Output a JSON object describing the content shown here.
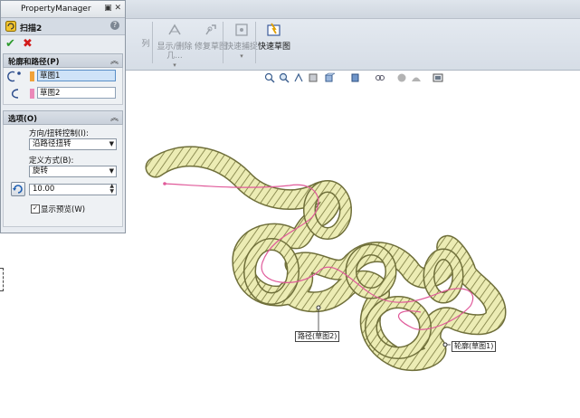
{
  "property_manager": {
    "title": "PropertyManager",
    "feature_name": "扫描2",
    "help": "?",
    "ok_symbol": "✔",
    "cancel_symbol": "✖",
    "profile_path_group": {
      "header": "轮廓和路径(P)",
      "profile_value": "草图1",
      "path_value": "草图2",
      "profile_color": "#f0a23a",
      "path_color": "#ea89b9"
    },
    "options_group": {
      "header": "选项(O)",
      "orientation_label": "方向/扭转控制(I):",
      "orientation_value": "沿路径扭转",
      "define_by_label": "定义方式(B):",
      "define_by_value": "旋转",
      "twist_value": "10.00",
      "show_preview_label": "显示预览(W)",
      "show_preview_checked": true
    }
  },
  "ribbon": {
    "items": [
      {
        "label": "列",
        "enabled": false
      },
      {
        "label": "显示/删除几...",
        "enabled": false
      },
      {
        "label": "修复草图",
        "enabled": false
      },
      {
        "label": "快速捕捉",
        "enabled": false
      },
      {
        "label": "快速草图",
        "enabled": true
      }
    ]
  },
  "view_toolbar": {
    "icons": [
      "zoom-to-fit-icon",
      "zoom-area-icon",
      "previous-view-icon",
      "section-view-icon",
      "view-orientation-icon",
      "display-style-icon",
      "hide-show-icon",
      "edit-appearance-icon",
      "apply-scene-icon",
      "view-settings-icon"
    ]
  },
  "graphics": {
    "sweep_color": "#e6e6a0",
    "path_line_color": "#e05a9a",
    "labels": {
      "path": "路径(草图2)",
      "profile": "轮廓(草图1)"
    }
  }
}
